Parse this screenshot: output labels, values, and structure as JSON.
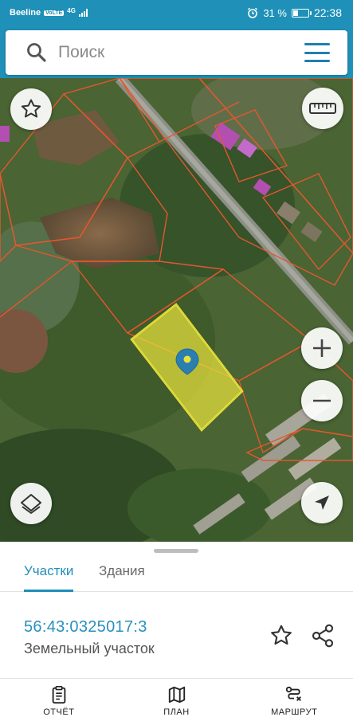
{
  "status_bar": {
    "carrier": "Beeline",
    "volte": "VoLTE",
    "network": "4G",
    "battery_text": "31 %",
    "battery_level": 0.31,
    "time": "22:38"
  },
  "search": {
    "placeholder": "Поиск"
  },
  "map": {
    "highlight_color": "#e8e23c",
    "boundary_color": "#e4572e",
    "marker_color": "#2a7fb0"
  },
  "sheet": {
    "tabs": [
      {
        "label": "Участки",
        "active": true
      },
      {
        "label": "Здания",
        "active": false
      }
    ],
    "selected_plot": {
      "cadastral_number": "56:43:0325017:3",
      "type": "Земельный участок"
    }
  },
  "bottom_nav": {
    "items": [
      {
        "label": "ОТЧЁТ",
        "icon": "clipboard-icon"
      },
      {
        "label": "ПЛАН",
        "icon": "map-icon"
      },
      {
        "label": "МАРШРУТ",
        "icon": "route-icon"
      }
    ]
  },
  "colors": {
    "accent": "#1f90b8",
    "link": "#2a8fc0"
  }
}
